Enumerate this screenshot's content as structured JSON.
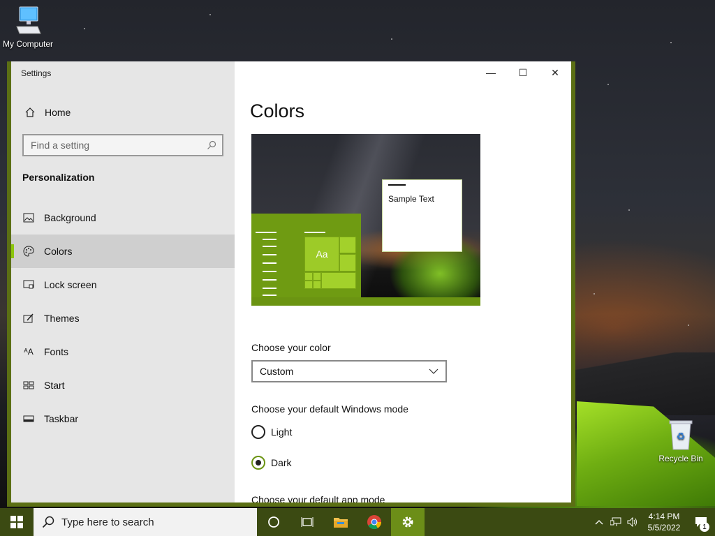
{
  "desktop": {
    "icons": [
      {
        "label": "My Computer",
        "icon": "computer-icon"
      },
      {
        "label": "Recycle Bin",
        "icon": "recycle-bin-icon"
      }
    ]
  },
  "window": {
    "app_title": "Settings",
    "accent_color": "#8cc60d",
    "controls": {
      "minimize": "—",
      "maximize": "☐",
      "close": "✕"
    }
  },
  "nav": {
    "home_label": "Home",
    "search_placeholder": "Find a setting",
    "section_title": "Personalization",
    "items": [
      {
        "label": "Background",
        "icon": "image-icon"
      },
      {
        "label": "Colors",
        "icon": "palette-icon",
        "selected": true
      },
      {
        "label": "Lock screen",
        "icon": "lock-screen-icon"
      },
      {
        "label": "Themes",
        "icon": "themes-icon"
      },
      {
        "label": "Fonts",
        "icon": "fonts-icon"
      },
      {
        "label": "Start",
        "icon": "start-icon"
      },
      {
        "label": "Taskbar",
        "icon": "taskbar-icon"
      }
    ]
  },
  "content": {
    "title": "Colors",
    "preview": {
      "sample_text": "Sample Text",
      "tile_text": "Aa"
    },
    "choose_color_label": "Choose your color",
    "color_value": "Custom",
    "windows_mode_label": "Choose your default Windows mode",
    "windows_mode_options": [
      {
        "label": "Light",
        "checked": false
      },
      {
        "label": "Dark",
        "checked": true
      }
    ],
    "app_mode_label": "Choose your default app mode"
  },
  "taskbar": {
    "search_placeholder": "Type here to search",
    "time": "4:14 PM",
    "date": "5/5/2022",
    "notification_count": "1"
  }
}
